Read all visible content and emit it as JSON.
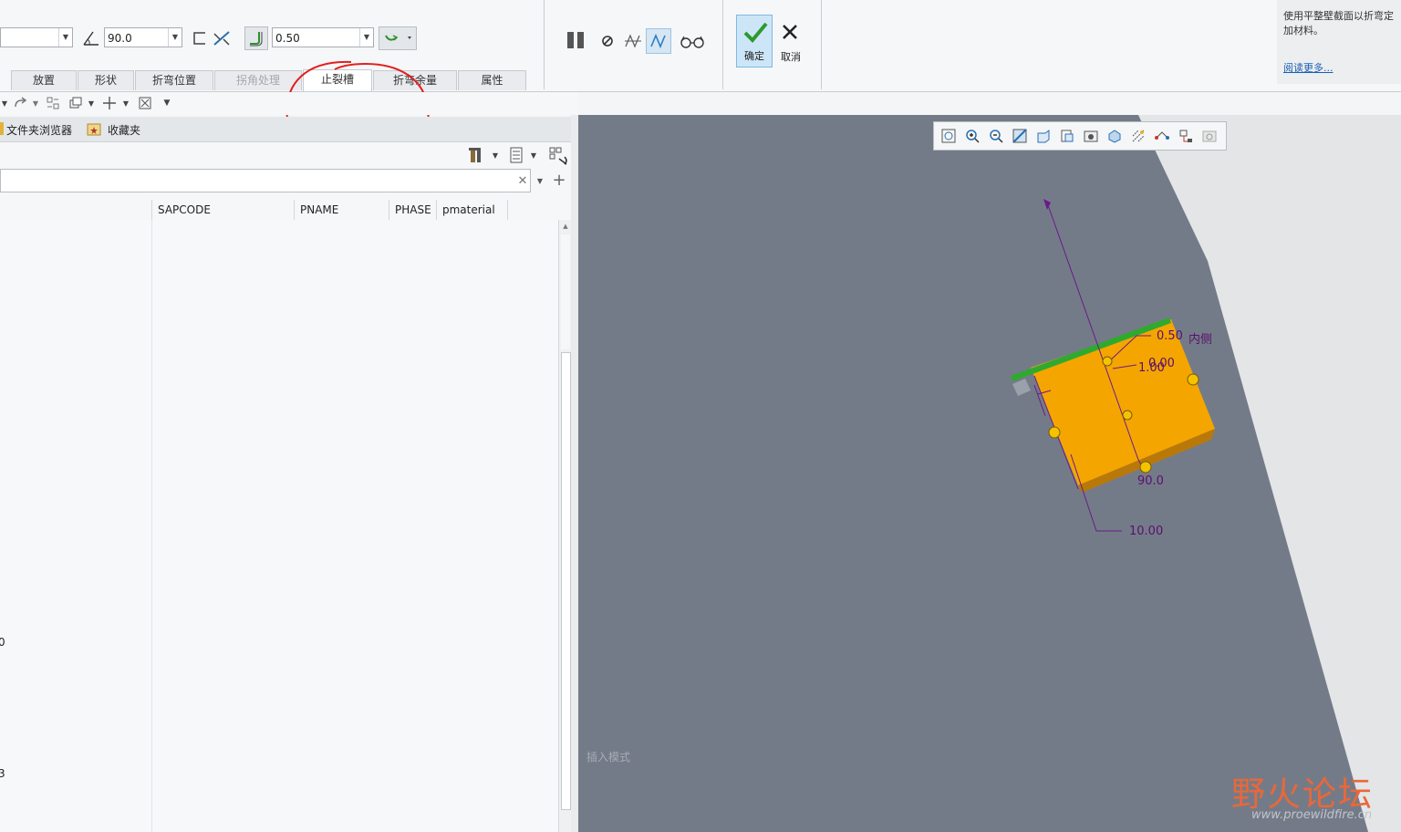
{
  "ribbon": {
    "angle_value": "90.0",
    "thickness_value": "0.50",
    "tabs": [
      {
        "label": "放置"
      },
      {
        "label": "形状"
      },
      {
        "label": "折弯位置"
      },
      {
        "label": "拐角处理"
      },
      {
        "label": "止裂槽"
      },
      {
        "label": "折弯余量"
      },
      {
        "label": "属性"
      }
    ],
    "ok_label": "确定",
    "cancel_label": "取消",
    "help_text": "使用平整壁截面以折弯定\n加材料。",
    "help_link": "阅读更多..."
  },
  "navigator": {
    "folder_browser": "文件夹浏览器",
    "favorites": "收藏夹"
  },
  "table": {
    "columns": [
      "SAPCODE",
      "PNAME",
      "PHASE",
      "pmaterial"
    ],
    "row_fragments": [
      "0",
      "3"
    ]
  },
  "viewport": {
    "dimensions": {
      "thickness": "0.50",
      "side": "内侧",
      "offset": "0.00",
      "radius": "1.00",
      "angle": "90.0",
      "length": "10.00"
    },
    "status": "插入模式"
  },
  "watermark": {
    "brand": "野火论坛",
    "url": "www.proewildfire.cn"
  },
  "colors": {
    "viewport_bg": "#747b88",
    "wall_color": "#f5a500",
    "annotation_color": "#7a0f7a",
    "circle_highlight": "#e02020"
  }
}
